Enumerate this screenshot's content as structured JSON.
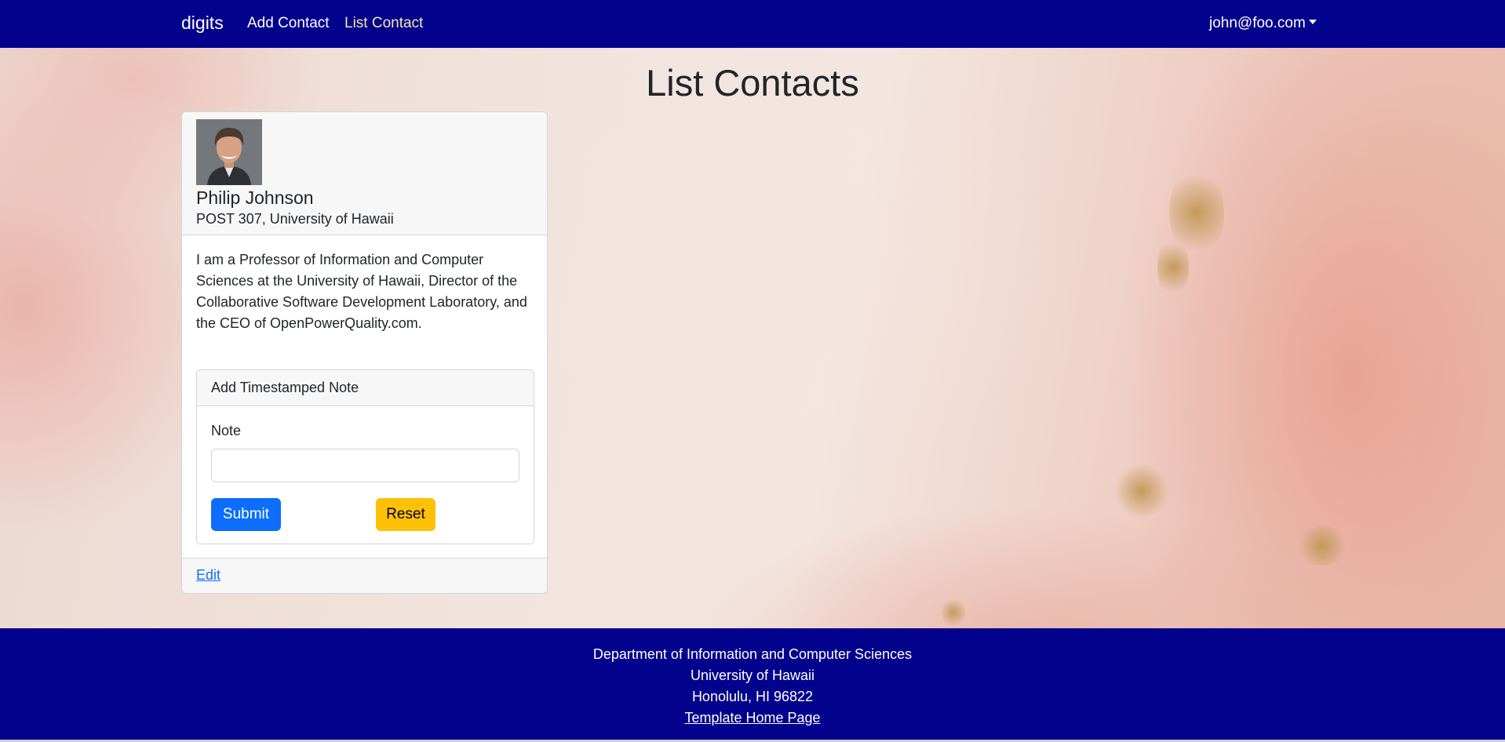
{
  "navbar": {
    "brand": "digits",
    "links": [
      {
        "label": "Add Contact"
      },
      {
        "label": "List Contact",
        "active": true
      }
    ],
    "user": "john@foo.com",
    "background_color": "#02028c",
    "active_link_color": "#f6e6a6"
  },
  "page": {
    "title": "List Contacts"
  },
  "contact": {
    "name": "Philip Johnson",
    "address": "POST 307, University of Hawaii",
    "description": "I am a Professor of Information and Computer Sciences at the University of Hawaii, Director of the Collaborative Software Development Laboratory, and the CEO of OpenPowerQuality.com.",
    "note_form": {
      "header": "Add Timestamped Note",
      "label": "Note",
      "value": "",
      "placeholder": "",
      "submit_label": "Submit",
      "reset_label": "Reset"
    },
    "edit_label": "Edit"
  },
  "footer": {
    "line1": "Department of Information and Computer Sciences",
    "line2": "University of Hawaii",
    "line3": "Honolulu, HI 96822",
    "link_label": "Template Home Page"
  },
  "colors": {
    "primary": "#0d6efd",
    "warning": "#ffc107",
    "footer_background": "#02028c"
  }
}
